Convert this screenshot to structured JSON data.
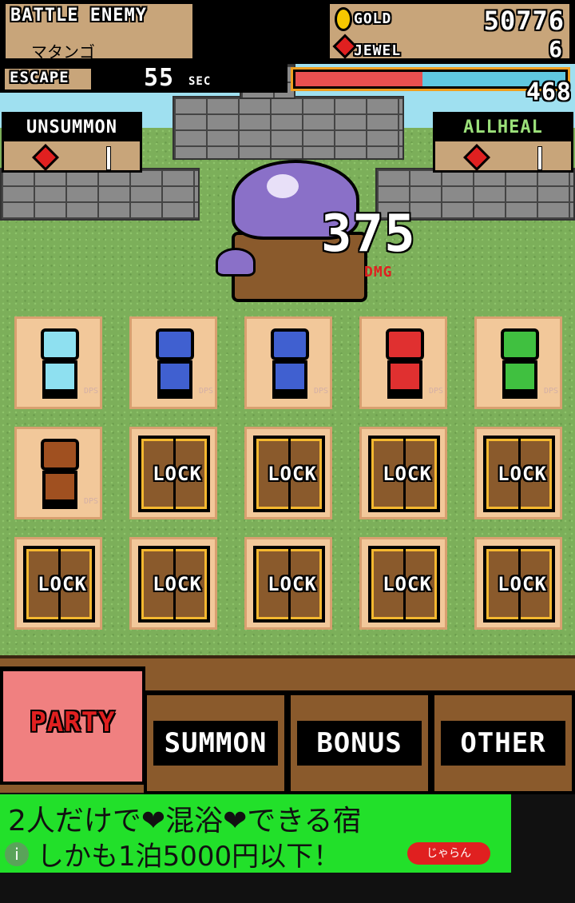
{
  "header": {
    "title": "BATTLE ENEMY",
    "enemy_name": "マタンゴ",
    "gold_label": "GOLD",
    "gold_value": "50776",
    "jewel_label": "JEWEL",
    "jewel_value": "6"
  },
  "battle": {
    "escape_label": "ESCAPE",
    "timer_value": "55",
    "timer_unit": "SEC",
    "enemy_hp_value": "468",
    "enemy_hp_fraction": 0.47,
    "damage_value": "375",
    "damage_label": "DMG",
    "unsummon_label": "UNSUMMON",
    "allheal_label": "ALLHEAL"
  },
  "party": {
    "heroes": [
      {
        "icon": "swordsman-icon",
        "color": "#8ee0f0",
        "dps": "DPS"
      },
      {
        "icon": "viking-knight-icon",
        "color": "#4060d0",
        "dps": "DPS"
      },
      {
        "icon": "viking-knight-icon",
        "color": "#4060d0",
        "dps": "DPS"
      },
      {
        "icon": "masked-warrior-icon",
        "color": "#e03030",
        "dps": "DPS"
      },
      {
        "icon": "cleric-icon",
        "color": "#40c040",
        "dps": "DPS"
      },
      {
        "icon": "spearman-icon",
        "color": "#a05020",
        "dps": "DPS"
      }
    ],
    "lock_label": "LOCK"
  },
  "tabs": [
    {
      "label": "PARTY",
      "active": true
    },
    {
      "label": "SUMMON",
      "active": false
    },
    {
      "label": "BONUS",
      "active": false
    },
    {
      "label": "OTHER",
      "active": false
    }
  ],
  "ad": {
    "line1": "2人だけで❤混浴❤できる宿",
    "line2": "しかも1泊5000円以下！",
    "logo": "じゃらん"
  }
}
